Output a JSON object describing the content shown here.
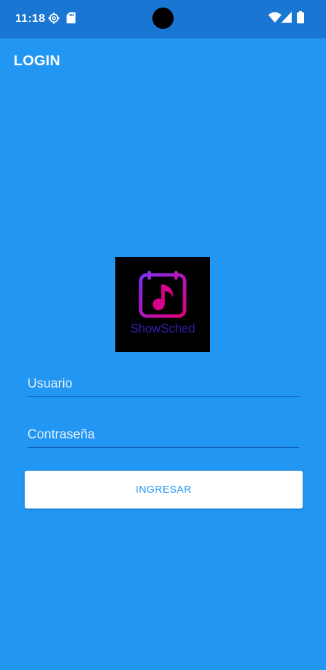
{
  "status_bar": {
    "time": "11:18",
    "left_icons": [
      "settings-gear-icon",
      "sd-card-icon"
    ],
    "right_icons": [
      "wifi-icon",
      "cellular-signal-icon",
      "battery-icon"
    ]
  },
  "app_bar": {
    "title": "LOGIN"
  },
  "logo": {
    "text": "ShowSched",
    "icon": "calendar-music-note-icon",
    "colors": {
      "background": "#000000",
      "gradient_start": "#7b2ff7",
      "gradient_end": "#e6007e",
      "text": "#3a1aa8"
    }
  },
  "form": {
    "username": {
      "placeholder": "Usuario",
      "value": ""
    },
    "password": {
      "placeholder": "Contraseña",
      "value": ""
    },
    "submit_label": "INGRESAR"
  },
  "colors": {
    "background": "#2196f3",
    "status_bar": "#1976d2",
    "field_underline": "#0d47a1",
    "button_background": "#ffffff",
    "button_text": "#2196f3"
  }
}
